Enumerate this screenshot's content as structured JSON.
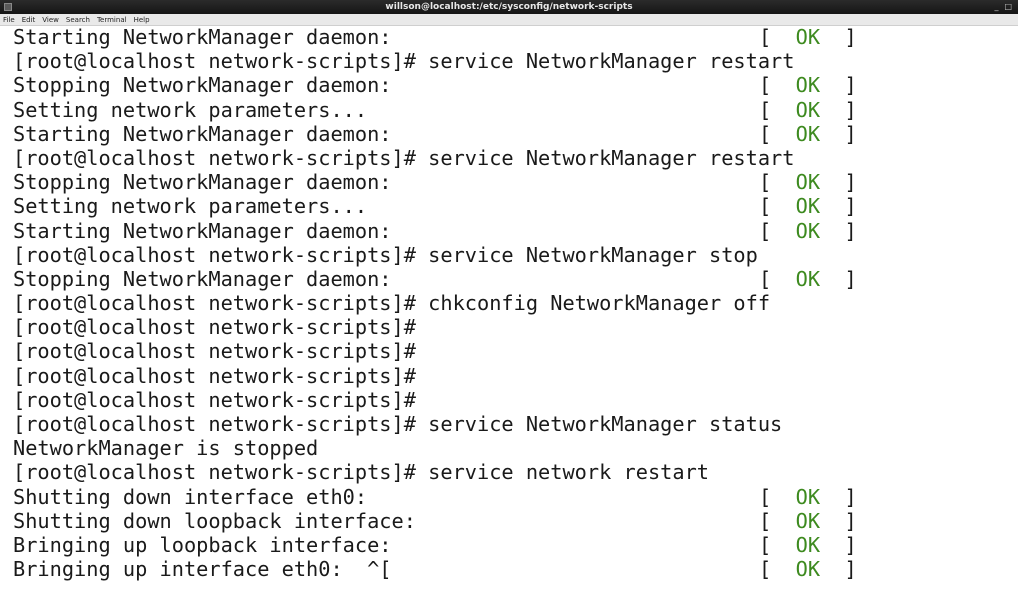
{
  "window": {
    "title": "willson@localhost:/etc/sysconfig/network-scripts",
    "controls": [
      "_",
      "□"
    ]
  },
  "menu": [
    "File",
    "Edit",
    "View",
    "Search",
    "Terminal",
    "Help"
  ],
  "colors": {
    "ok": "#3d8a1f",
    "text": "#1a1a1a",
    "background": "#ffffff"
  },
  "terminal": {
    "lines": [
      {
        "text": "Starting NetworkManager daemon:",
        "status": "OK"
      },
      {
        "text": "[root@localhost network-scripts]# service NetworkManager restart",
        "status": ""
      },
      {
        "text": "Stopping NetworkManager daemon:",
        "status": "OK"
      },
      {
        "text": "Setting network parameters...",
        "status": "OK"
      },
      {
        "text": "Starting NetworkManager daemon:",
        "status": "OK"
      },
      {
        "text": "[root@localhost network-scripts]# service NetworkManager restart",
        "status": ""
      },
      {
        "text": "Stopping NetworkManager daemon:",
        "status": "OK"
      },
      {
        "text": "Setting network parameters...",
        "status": "OK"
      },
      {
        "text": "Starting NetworkManager daemon:",
        "status": "OK"
      },
      {
        "text": "[root@localhost network-scripts]# service NetworkManager stop",
        "status": ""
      },
      {
        "text": "Stopping NetworkManager daemon:",
        "status": "OK"
      },
      {
        "text": "[root@localhost network-scripts]# chkconfig NetworkManager off",
        "status": ""
      },
      {
        "text": "[root@localhost network-scripts]#",
        "status": ""
      },
      {
        "text": "[root@localhost network-scripts]#",
        "status": ""
      },
      {
        "text": "[root@localhost network-scripts]#",
        "status": ""
      },
      {
        "text": "[root@localhost network-scripts]#",
        "status": ""
      },
      {
        "text": "[root@localhost network-scripts]# service NetworkManager status",
        "status": ""
      },
      {
        "text": "NetworkManager is stopped",
        "status": ""
      },
      {
        "text": "[root@localhost network-scripts]# service network restart",
        "status": ""
      },
      {
        "text": "Shutting down interface eth0:",
        "status": "OK"
      },
      {
        "text": "Shutting down loopback interface:",
        "status": "OK"
      },
      {
        "text": "Bringing up loopback interface:",
        "status": "OK"
      },
      {
        "text": "Bringing up interface eth0:  ^[",
        "status": "OK"
      }
    ]
  }
}
